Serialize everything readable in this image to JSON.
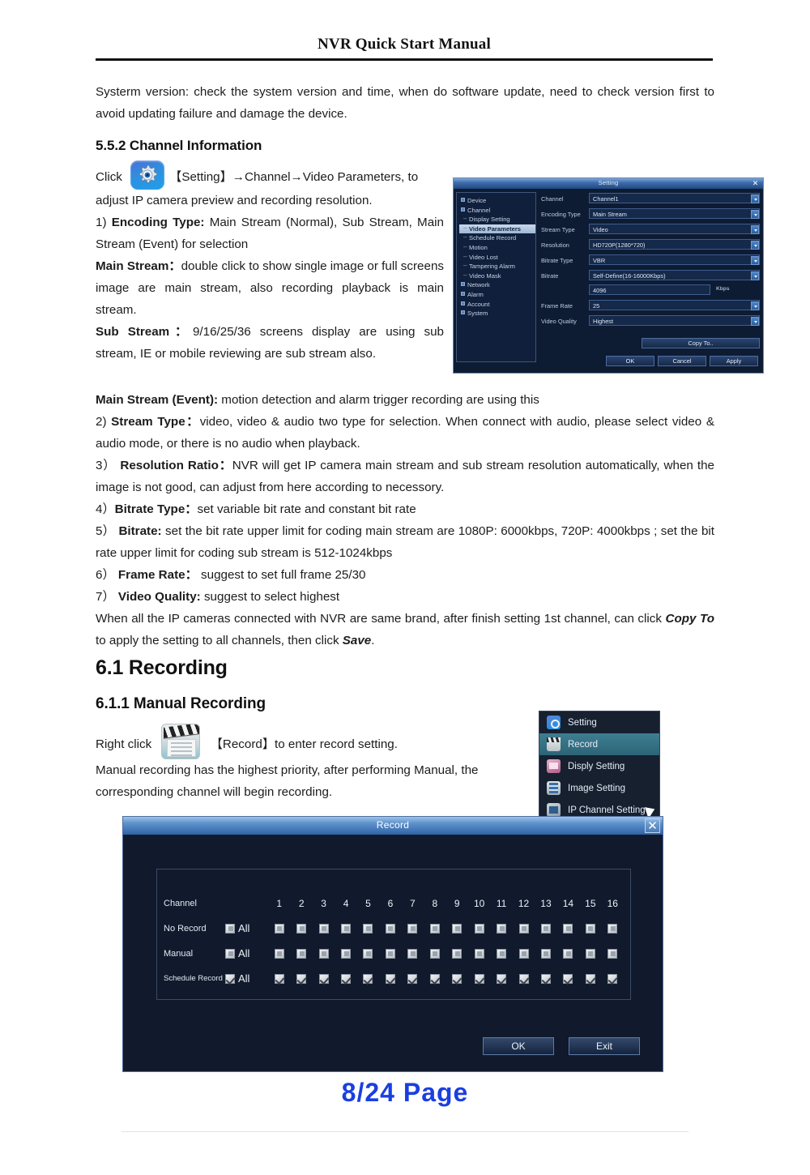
{
  "header": {
    "title": "NVR Quick Start Manual"
  },
  "intro": {
    "text": "Systerm version: check the system version and time, when do software update, need to check version first to avoid updating failure and damage the device."
  },
  "section_552": {
    "heading": "5.5.2 Channel Information",
    "click_prefix": "Click",
    "click_path": "【Setting】→Channel→Video Parameters,",
    "click_tail": "to adjust IP camera preview and recording resolution.",
    "item1_num": "1)",
    "item1_label": "Encoding Type:",
    "item1_text": "Main Stream (Normal), Sub Stream, Main Stream (Event) for selection",
    "main_stream_label": "Main Stream：",
    "main_stream_text": "double click to show single image or full screens image are main stream, also recording playback is main stream.",
    "sub_stream_label": "Sub Stream：",
    "sub_stream_text": "9/16/25/36 screens display are using sub stream, IE or mobile   reviewing are sub stream also.",
    "main_event_label": "Main Stream (Event):",
    "main_event_text": "motion detection and alarm trigger recording are using this",
    "item2_num": "2)",
    "item2_label": "Stream Type：",
    "item2_text": "video, video & audio two type for selection. When connect with audio, please select video & audio mode, or there is no audio when playback.",
    "item3_num": "3）",
    "item3_label": "Resolution Ratio：",
    "item3_text": "NVR will get IP camera main stream and sub stream resolution automatically, when the image is not good, can adjust from here according to necessory.",
    "item4_num": "4）",
    "item4_label": "Bitrate Type：",
    "item4_text": "set variable bit rate and constant bit rate",
    "item5_num": "5）",
    "item5_label": "Bitrate:",
    "item5_text": "set the bit rate upper limit for coding main stream are 1080P: 6000kbps, 720P: 4000kbps ; set the bit rate upper limit for coding sub stream is 512-1024kbps",
    "item6_num": "6）",
    "item6_label": "Frame Rate：",
    "item6_text": "suggest to set full frame 25/30",
    "item7_num": "7）",
    "item7_label": "Video Quality:",
    "item7_text": "suggest to select highest",
    "closing_a": "When all the IP cameras connected with NVR are same brand, after finish setting 1st channel, can click ",
    "closing_copy": "Copy To",
    "closing_b": " to apply the setting to all channels, then click ",
    "closing_save": "Save",
    "closing_c": "."
  },
  "section_61": {
    "heading": "6.1 Recording",
    "sub_heading": "6.1.1 Manual Recording",
    "right_click_prefix": "Right click",
    "right_click_suffix": "【Record】to enter record setting.",
    "body": "Manual recording has the highest priority, after performing Manual, the corresponding channel will begin recording."
  },
  "setting_dialog": {
    "title": "Setting",
    "close_glyph": "✕",
    "tree": [
      {
        "label": "Device",
        "level": "root",
        "selected": false
      },
      {
        "label": "Channel",
        "level": "root",
        "selected": false
      },
      {
        "label": "Display Setting",
        "level": "child",
        "selected": false
      },
      {
        "label": "Video Parameters",
        "level": "child",
        "selected": true
      },
      {
        "label": "Schedule Record",
        "level": "child",
        "selected": false
      },
      {
        "label": "Motion",
        "level": "child",
        "selected": false
      },
      {
        "label": "Video Lost",
        "level": "child",
        "selected": false
      },
      {
        "label": "Tampering Alarm",
        "level": "child",
        "selected": false
      },
      {
        "label": "Video Mask",
        "level": "child",
        "selected": false
      },
      {
        "label": "Network",
        "level": "root",
        "selected": false
      },
      {
        "label": "Alarm",
        "level": "root",
        "selected": false
      },
      {
        "label": "Account",
        "level": "root",
        "selected": false
      },
      {
        "label": "System",
        "level": "root",
        "selected": false
      }
    ],
    "fields": [
      {
        "label": "Channel",
        "value": "Channel1"
      },
      {
        "label": "Encoding Type",
        "value": "Main Stream"
      },
      {
        "label": "Stream Type",
        "value": "Video"
      },
      {
        "label": "Resolution",
        "value": "HD720P(1280*720)"
      },
      {
        "label": "Bitrate Type",
        "value": "VBR"
      },
      {
        "label": "Bitrate",
        "value": "Self-Define(16-16000Kbps)"
      }
    ],
    "bitrate_value": "4096",
    "bitrate_unit": "Kbps",
    "frame_rate": {
      "label": "Frame Rate",
      "value": "25"
    },
    "video_quality": {
      "label": "Video Quality",
      "value": "Highest"
    },
    "copy_to": "Copy To..",
    "ok": "OK",
    "cancel": "Cancel",
    "apply": "Apply"
  },
  "context_menu": {
    "items": [
      {
        "label": "Setting",
        "icon": "gear-icon",
        "active": false
      },
      {
        "label": "Record",
        "icon": "clapper-icon",
        "active": true
      },
      {
        "label": "Disply Setting",
        "icon": "display-icon",
        "active": false
      },
      {
        "label": "Image Setting",
        "icon": "image-icon",
        "active": false
      },
      {
        "label": "IP Channel Setting",
        "icon": "ip-channel-icon",
        "active": false
      }
    ]
  },
  "record_dialog": {
    "title": "Record",
    "close_glyph": "✕",
    "channel_label": "Channel",
    "all_label": "All",
    "channels": [
      "1",
      "2",
      "3",
      "4",
      "5",
      "6",
      "7",
      "8",
      "9",
      "10",
      "11",
      "12",
      "13",
      "14",
      "15",
      "16"
    ],
    "rows": [
      {
        "label": "No Record",
        "all_checked": false,
        "checked": [
          false,
          false,
          false,
          false,
          false,
          false,
          false,
          false,
          false,
          false,
          false,
          false,
          false,
          false,
          false,
          false
        ]
      },
      {
        "label": "Manual",
        "all_checked": false,
        "checked": [
          false,
          false,
          false,
          false,
          false,
          false,
          false,
          false,
          false,
          false,
          false,
          false,
          false,
          false,
          false,
          false
        ]
      },
      {
        "label": "Schedule Record",
        "all_checked": true,
        "checked": [
          true,
          true,
          true,
          true,
          true,
          true,
          true,
          true,
          true,
          true,
          true,
          true,
          true,
          true,
          true,
          true
        ]
      }
    ],
    "ok": "OK",
    "exit": "Exit"
  },
  "footer": {
    "page": "8/24   Page"
  },
  "colors": {
    "accent_blue": "#1a3fe0",
    "dialog_bg": "#101a2c",
    "titlebar_blue": "#2e62a6",
    "highlight": "#2d6477"
  }
}
